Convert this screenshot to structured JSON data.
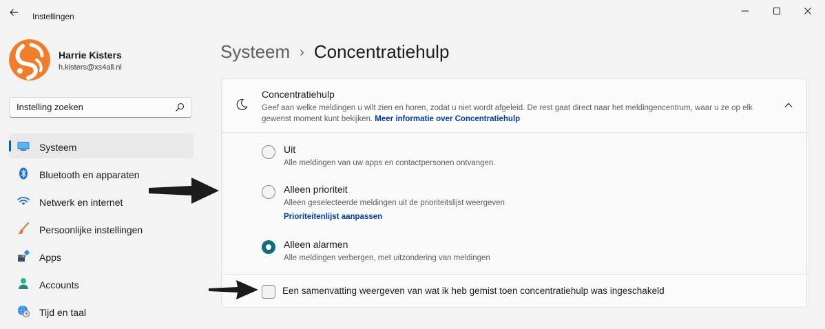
{
  "window": {
    "title": "Instellingen",
    "controls": [
      "minimize",
      "maximize",
      "close"
    ]
  },
  "profile": {
    "name": "Harrie Kisters",
    "email": "h.kisters@xs4all.nl"
  },
  "search": {
    "placeholder": "Instelling zoeken"
  },
  "sidebar": {
    "items": [
      {
        "label": "Systeem",
        "icon": "monitor-icon",
        "active": true
      },
      {
        "label": "Bluetooth en apparaten",
        "icon": "bluetooth-icon",
        "active": false
      },
      {
        "label": "Netwerk en internet",
        "icon": "wifi-icon",
        "active": false
      },
      {
        "label": "Persoonlijke instellingen",
        "icon": "brush-icon",
        "active": false
      },
      {
        "label": "Apps",
        "icon": "apps-icon",
        "active": false
      },
      {
        "label": "Accounts",
        "icon": "person-icon",
        "active": false
      },
      {
        "label": "Tijd en taal",
        "icon": "globe-clock-icon",
        "active": false
      }
    ]
  },
  "page": {
    "breadcrumb_parent": "Systeem",
    "breadcrumb_separator": "›",
    "title": "Concentratiehulp"
  },
  "focus_card": {
    "title": "Concentratiehulp",
    "description": "Geef aan welke meldingen u wilt zien en horen, zodat u niet wordt afgeleid. De rest gaat direct naar het meldingencentrum, waar u ze op elk gewenst moment kunt bekijken.",
    "link": "Meer informatie over Concentratiehulp",
    "expanded": true,
    "options": [
      {
        "label": "Uit",
        "description": "Alle meldingen van uw apps en contactpersonen ontvangen.",
        "checked": false
      },
      {
        "label": "Alleen prioriteit",
        "description": "Alleen geselecteerde meldingen uit de prioriteitslijst weergeven",
        "link": "Prioriteitenlijst aanpassen",
        "checked": false
      },
      {
        "label": "Alleen alarmen",
        "description": "Alle meldingen verbergen, met uitzondering van meldingen",
        "checked": true
      }
    ],
    "summary_checkbox": {
      "label": "Een samenvatting weergeven van wat ik heb gemist toen concentratiehulp was ingeschakeld",
      "checked": false
    }
  },
  "colors": {
    "accent": "#0f6e7a",
    "link": "#003e92",
    "nav_indicator": "#005fb8",
    "background": "#f3f3f3",
    "annotation_arrow": "#1b1b1b"
  }
}
